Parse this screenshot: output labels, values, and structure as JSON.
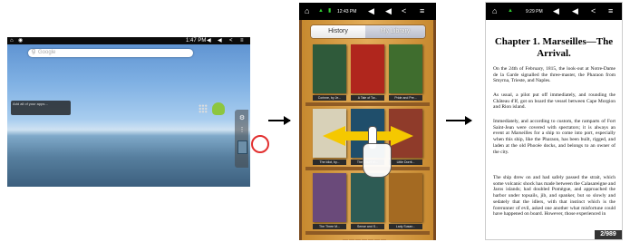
{
  "home": {
    "status_time": "1:47 PM",
    "search_placeholder": "Google",
    "widget_text": "Add all of your apps…",
    "icons": [
      "home-icon",
      "wifi-icon",
      "back-icon",
      "menu-icon",
      "settings-icon",
      "apps-icon",
      "android-icon",
      "ereader-app-icon"
    ]
  },
  "library": {
    "status_time": "12:43 PM",
    "tab_history": "History",
    "tab_library": "My Library",
    "books": [
      {
        "label": "Corinne, by Je...",
        "color": "#2f5a3a"
      },
      {
        "label": "A Tale of Tw...",
        "color": "#b0261d"
      },
      {
        "label": "Pride and Pre...",
        "color": "#3f6d2e"
      },
      {
        "label": "The Idiot, by...",
        "color": "#d8d1b8"
      },
      {
        "label": "The Count of...",
        "color": "#1f4e6b"
      },
      {
        "label": "Little Dorrit...",
        "color": "#8f3b2a"
      },
      {
        "label": "The Three M...",
        "color": "#6a4a7a"
      },
      {
        "label": "Sense and S...",
        "color": "#2d5b54"
      },
      {
        "label": "Lady Susan...",
        "color": "#a46a22"
      }
    ]
  },
  "reader": {
    "status_time": "9:29 PM",
    "chapter_title": "Chapter 1. Marseilles—The Arrival.",
    "paragraphs": [
      "On the 24th of February, 1815, the look-out at Notre-Dame de la Garde signalled the three-master, the Pharaon from Smyrna, Trieste, and Naples.",
      "As usual, a pilot put off immediately, and rounding the Château d'If, got on board the vessel between Cape Morgion and Rion island.",
      "Immediately, and according to custom, the ramparts of Fort Saint-Jean were covered with spectators; it is always an event at Marseilles for a ship to come into port, especially when this ship, like the Pharaon, has been built, rigged, and laden at the old Phocée docks, and belongs to an owner of the city.",
      "The ship drew on and had safely passed the strait, which some volcanic shock has made between the Calasareigne and Jaros islands; had doubled Pomègue, and approached the harbor under topsails, jib, and spanker, but so slowly and sedately that the idlers, with that instinct which is the forerunner of evil, asked one another what misfortune could have happened on board. However, those experienced in"
    ],
    "page_indicator": "2/989"
  }
}
